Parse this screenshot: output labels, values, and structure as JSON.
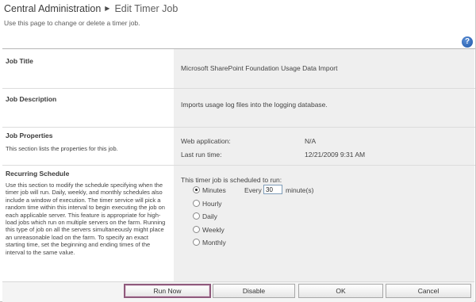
{
  "header": {
    "breadcrumb_root": "Central Administration",
    "breadcrumb_current": "Edit Timer Job",
    "subtitle": "Use this page to change or delete a timer job.",
    "help_glyph": "?"
  },
  "sections": {
    "job_title": {
      "label": "Job Title",
      "value": "Microsoft SharePoint Foundation Usage Data Import"
    },
    "job_description": {
      "label": "Job Description",
      "value": "Imports usage log files into the logging database."
    },
    "job_properties": {
      "label": "Job Properties",
      "description": "This section lists the properties for this job.",
      "web_app_label": "Web application:",
      "web_app_value": "N/A",
      "last_run_label": "Last run time:",
      "last_run_value": "12/21/2009 9:31 AM"
    },
    "recurring_schedule": {
      "label": "Recurring Schedule",
      "description": "Use this section to modify the schedule specifying when the timer job will run. Daily, weekly, and monthly schedules also include a window of execution. The timer service will pick a random time within this interval to begin executing the job on each applicable server. This feature is appropriate for high-load jobs which run on multiple servers on the farm. Running this type of job on all the servers simultaneously might place an unreasonable load on the farm. To specify an exact starting time, set the beginning and ending times of the interval to the same value.",
      "intro": "This timer job is scheduled to run:",
      "options": [
        "Minutes",
        "Hourly",
        "Daily",
        "Weekly",
        "Monthly"
      ],
      "selected": "Minutes",
      "every_label": "Every",
      "every_value": "30",
      "every_unit": "minute(s)"
    }
  },
  "buttons": {
    "run_now": "Run Now",
    "disable": "Disable",
    "ok": "OK",
    "cancel": "Cancel"
  }
}
